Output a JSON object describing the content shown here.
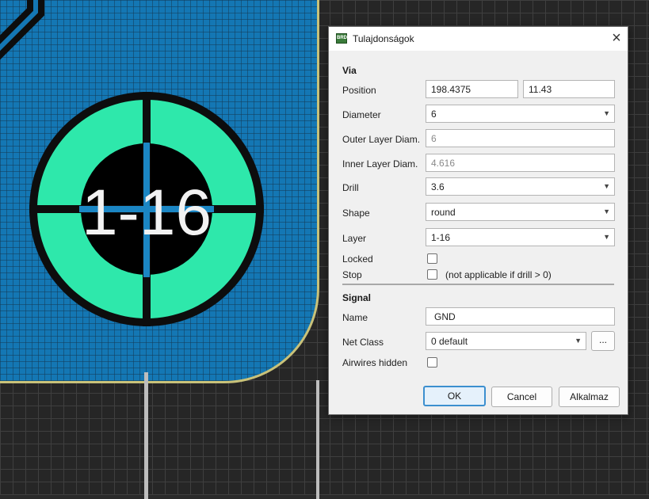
{
  "canvas": {
    "via_label": "1-16",
    "colors": {
      "board": "#1477b4",
      "via_pad": "#2ee8ab",
      "board_edge": "#c9c279"
    }
  },
  "dialog": {
    "title": "Tulajdonságok",
    "close_icon": "close-icon",
    "app_icon": "bitmap-icon",
    "via": {
      "section": "Via",
      "position_label": "Position",
      "position_x": "198.4375",
      "position_y": "11.43",
      "diameter_label": "Diameter",
      "diameter_value": "6",
      "outer_label": "Outer Layer Diam.",
      "outer_value": "6",
      "inner_label": "Inner Layer Diam.",
      "inner_value": "4.616",
      "drill_label": "Drill",
      "drill_value": "3.6",
      "shape_label": "Shape",
      "shape_value": "round",
      "layer_label": "Layer",
      "layer_value": "1-16",
      "locked_label": "Locked",
      "locked_checked": false,
      "stop_label": "Stop",
      "stop_checked": false,
      "stop_note": "(not applicable if drill > 0)"
    },
    "signal": {
      "section": "Signal",
      "name_label": "Name",
      "name_value": "GND",
      "netclass_label": "Net Class",
      "netclass_value": "0 default",
      "netclass_more": "...",
      "airwires_label": "Airwires hidden",
      "airwires_checked": false
    },
    "buttons": {
      "ok": "OK",
      "cancel": "Cancel",
      "apply": "Alkalmaz"
    }
  }
}
